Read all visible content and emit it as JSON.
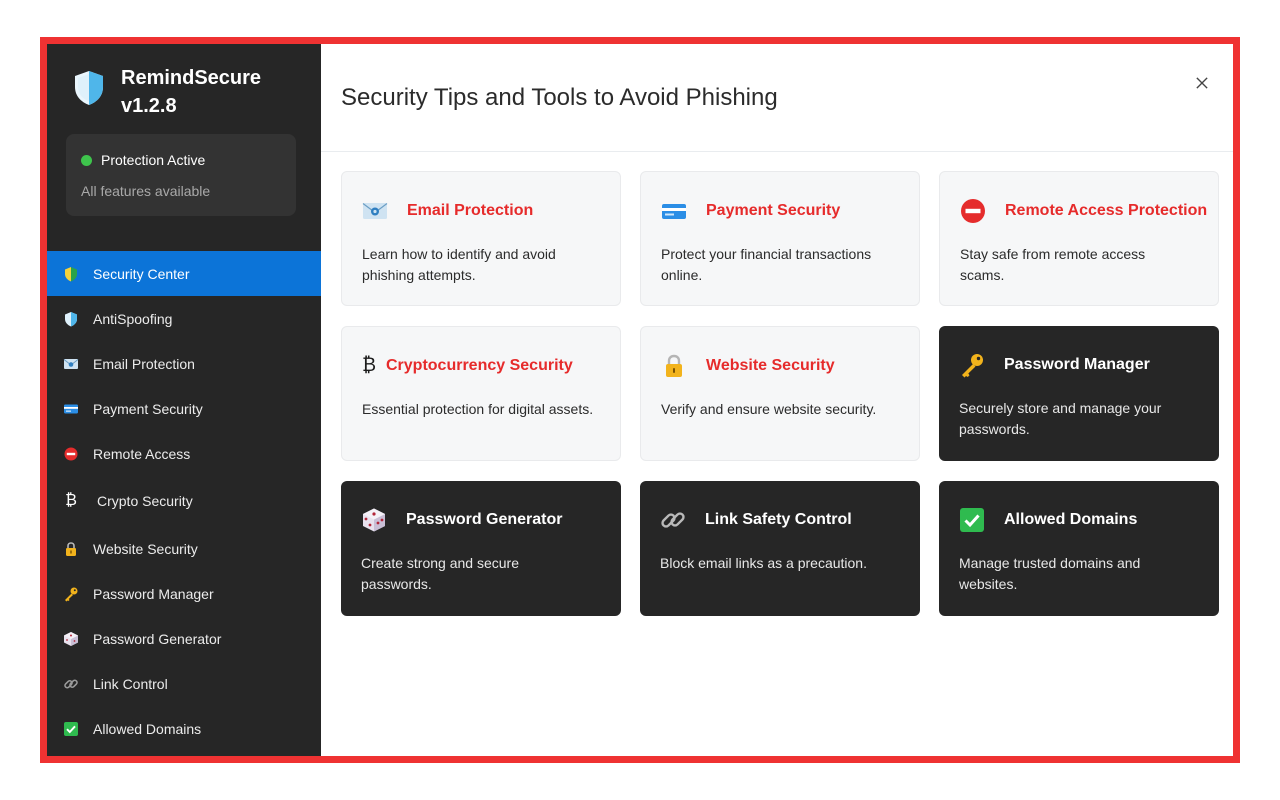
{
  "app": {
    "name": "RemindSecure",
    "version": "v1.2.8"
  },
  "status": {
    "title": "Protection Active",
    "subtitle": "All features available",
    "color": "#3ec44c"
  },
  "sidebar": {
    "items": [
      {
        "label": "Security Center",
        "icon": "shield-split-icon",
        "active": true
      },
      {
        "label": "AntiSpoofing",
        "icon": "shield-icon"
      },
      {
        "label": "Email Protection",
        "icon": "envelope-icon"
      },
      {
        "label": "Payment Security",
        "icon": "credit-card-icon"
      },
      {
        "label": "Remote Access",
        "icon": "no-entry-icon"
      },
      {
        "label": "Crypto Security",
        "icon": "bitcoin-icon"
      },
      {
        "label": "Website Security",
        "icon": "lock-icon"
      },
      {
        "label": "Password Manager",
        "icon": "key-icon"
      },
      {
        "label": "Password Generator",
        "icon": "dice-icon"
      },
      {
        "label": "Link Control",
        "icon": "link-icon"
      },
      {
        "label": "Allowed Domains",
        "icon": "check-box-icon"
      }
    ]
  },
  "header": {
    "title": "Security Tips and Tools to Avoid Phishing",
    "close_icon": "close-icon"
  },
  "cards": [
    {
      "title": "Email Protection",
      "description": "Learn how to identify and avoid phishing attempts.",
      "icon": "envelope-icon",
      "theme": "light"
    },
    {
      "title": "Payment Security",
      "description": "Protect your financial transactions online.",
      "icon": "credit-card-icon",
      "theme": "light"
    },
    {
      "title": "Remote Access Protection",
      "description": "Stay safe from remote access scams.",
      "icon": "no-entry-icon",
      "theme": "light"
    },
    {
      "title": "Cryptocurrency Security",
      "description": "Essential protection for digital assets.",
      "icon": "bitcoin-icon",
      "theme": "light"
    },
    {
      "title": "Website Security",
      "description": "Verify and ensure website security.",
      "icon": "lock-icon",
      "theme": "light"
    },
    {
      "title": "Password Manager",
      "description": "Securely store and manage your passwords.",
      "icon": "key-icon",
      "theme": "dark"
    },
    {
      "title": "Password Generator",
      "description": "Create strong and secure passwords.",
      "icon": "dice-icon",
      "theme": "dark"
    },
    {
      "title": "Link Safety Control",
      "description": "Block email links as a precaution.",
      "icon": "link-icon",
      "theme": "dark"
    },
    {
      "title": "Allowed Domains",
      "description": "Manage trusted domains and websites.",
      "icon": "check-box-icon",
      "theme": "dark"
    }
  ],
  "colors": {
    "accent": "#0c74d8",
    "sidebar_bg": "#262626",
    "card_title_red": "#e62b2b",
    "frame_border": "#ef3232"
  }
}
